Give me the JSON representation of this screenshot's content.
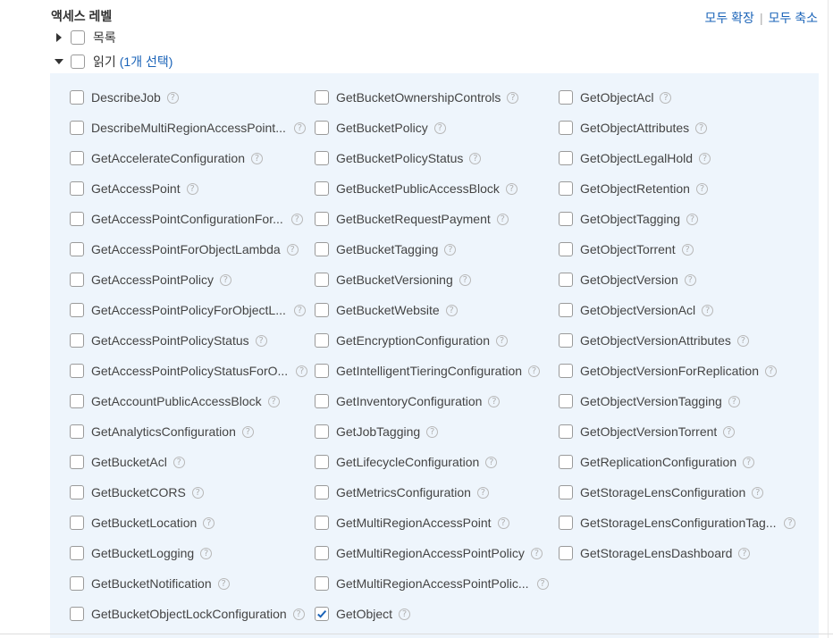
{
  "header": {
    "title": "액세스 레벨",
    "expand_all": "모두 확장",
    "collapse_all": "모두 축소",
    "separator": "|"
  },
  "groups": [
    {
      "label": "목록",
      "expanded": false,
      "count_text": ""
    },
    {
      "label": "읽기",
      "expanded": true,
      "count_text": "(1개 선택)"
    }
  ],
  "help_glyph": "?",
  "columns": [
    [
      {
        "label": "DescribeJob",
        "checked": false
      },
      {
        "label": "DescribeMultiRegionAccessPoint...",
        "checked": false
      },
      {
        "label": "GetAccelerateConfiguration",
        "checked": false
      },
      {
        "label": "GetAccessPoint",
        "checked": false
      },
      {
        "label": "GetAccessPointConfigurationFor...",
        "checked": false
      },
      {
        "label": "GetAccessPointForObjectLambda",
        "checked": false
      },
      {
        "label": "GetAccessPointPolicy",
        "checked": false
      },
      {
        "label": "GetAccessPointPolicyForObjectL...",
        "checked": false
      },
      {
        "label": "GetAccessPointPolicyStatus",
        "checked": false
      },
      {
        "label": "GetAccessPointPolicyStatusForO...",
        "checked": false
      },
      {
        "label": "GetAccountPublicAccessBlock",
        "checked": false
      },
      {
        "label": "GetAnalyticsConfiguration",
        "checked": false
      },
      {
        "label": "GetBucketAcl",
        "checked": false
      },
      {
        "label": "GetBucketCORS",
        "checked": false
      },
      {
        "label": "GetBucketLocation",
        "checked": false
      },
      {
        "label": "GetBucketLogging",
        "checked": false
      },
      {
        "label": "GetBucketNotification",
        "checked": false
      },
      {
        "label": "GetBucketObjectLockConfiguration",
        "checked": false
      }
    ],
    [
      {
        "label": "GetBucketOwnershipControls",
        "checked": false
      },
      {
        "label": "GetBucketPolicy",
        "checked": false
      },
      {
        "label": "GetBucketPolicyStatus",
        "checked": false
      },
      {
        "label": "GetBucketPublicAccessBlock",
        "checked": false
      },
      {
        "label": "GetBucketRequestPayment",
        "checked": false
      },
      {
        "label": "GetBucketTagging",
        "checked": false
      },
      {
        "label": "GetBucketVersioning",
        "checked": false
      },
      {
        "label": "GetBucketWebsite",
        "checked": false
      },
      {
        "label": "GetEncryptionConfiguration",
        "checked": false
      },
      {
        "label": "GetIntelligentTieringConfiguration",
        "checked": false
      },
      {
        "label": "GetInventoryConfiguration",
        "checked": false
      },
      {
        "label": "GetJobTagging",
        "checked": false
      },
      {
        "label": "GetLifecycleConfiguration",
        "checked": false
      },
      {
        "label": "GetMetricsConfiguration",
        "checked": false
      },
      {
        "label": "GetMultiRegionAccessPoint",
        "checked": false
      },
      {
        "label": "GetMultiRegionAccessPointPolicy",
        "checked": false
      },
      {
        "label": "GetMultiRegionAccessPointPolic...",
        "checked": false
      },
      {
        "label": "GetObject",
        "checked": true
      }
    ],
    [
      {
        "label": "GetObjectAcl",
        "checked": false
      },
      {
        "label": "GetObjectAttributes",
        "checked": false
      },
      {
        "label": "GetObjectLegalHold",
        "checked": false
      },
      {
        "label": "GetObjectRetention",
        "checked": false
      },
      {
        "label": "GetObjectTagging",
        "checked": false
      },
      {
        "label": "GetObjectTorrent",
        "checked": false
      },
      {
        "label": "GetObjectVersion",
        "checked": false
      },
      {
        "label": "GetObjectVersionAcl",
        "checked": false
      },
      {
        "label": "GetObjectVersionAttributes",
        "checked": false
      },
      {
        "label": "GetObjectVersionForReplication",
        "checked": false
      },
      {
        "label": "GetObjectVersionTagging",
        "checked": false
      },
      {
        "label": "GetObjectVersionTorrent",
        "checked": false
      },
      {
        "label": "GetReplicationConfiguration",
        "checked": false
      },
      {
        "label": "GetStorageLensConfiguration",
        "checked": false
      },
      {
        "label": "GetStorageLensConfigurationTag...",
        "checked": false
      },
      {
        "label": "GetStorageLensDashboard",
        "checked": false
      }
    ]
  ],
  "colors": {
    "link": "#1a63b8",
    "panel_bg": "#eef5fc",
    "check": "#1a63b8"
  }
}
